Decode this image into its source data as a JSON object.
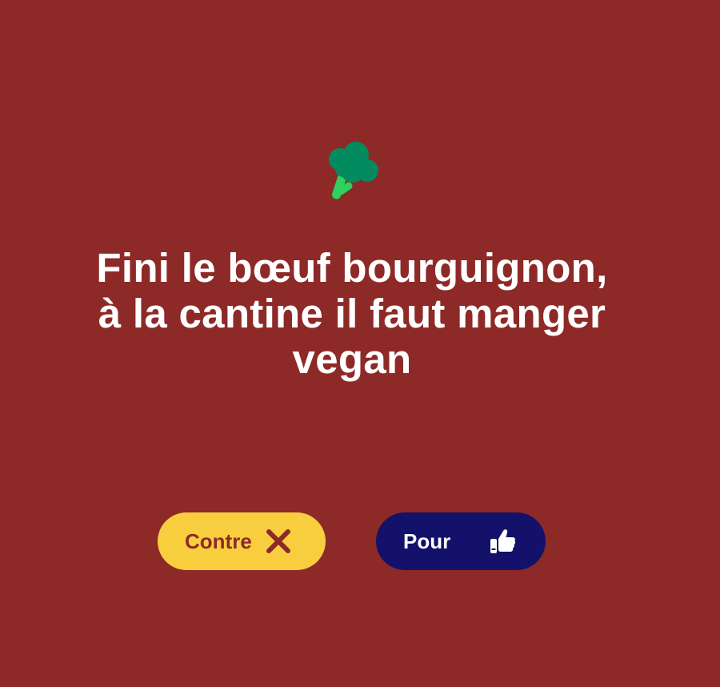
{
  "question": {
    "emoji_icon": "broccoli-icon",
    "line1": "Fini le bœuf bourguignon,",
    "line2": "à la cantine il faut manger",
    "line3": "vegan"
  },
  "buttons": {
    "contre": {
      "label": "Contre",
      "icon": "close-icon",
      "bg": "#f8ce3e",
      "fg": "#8d2a27"
    },
    "pour": {
      "label": "Pour",
      "icon": "thumbs-up-icon",
      "bg": "#13116a",
      "fg": "#ffffff"
    }
  },
  "colors": {
    "background": "#8d2a27",
    "broccoli_head": "#038a5e",
    "broccoli_stem": "#2fd15d"
  }
}
